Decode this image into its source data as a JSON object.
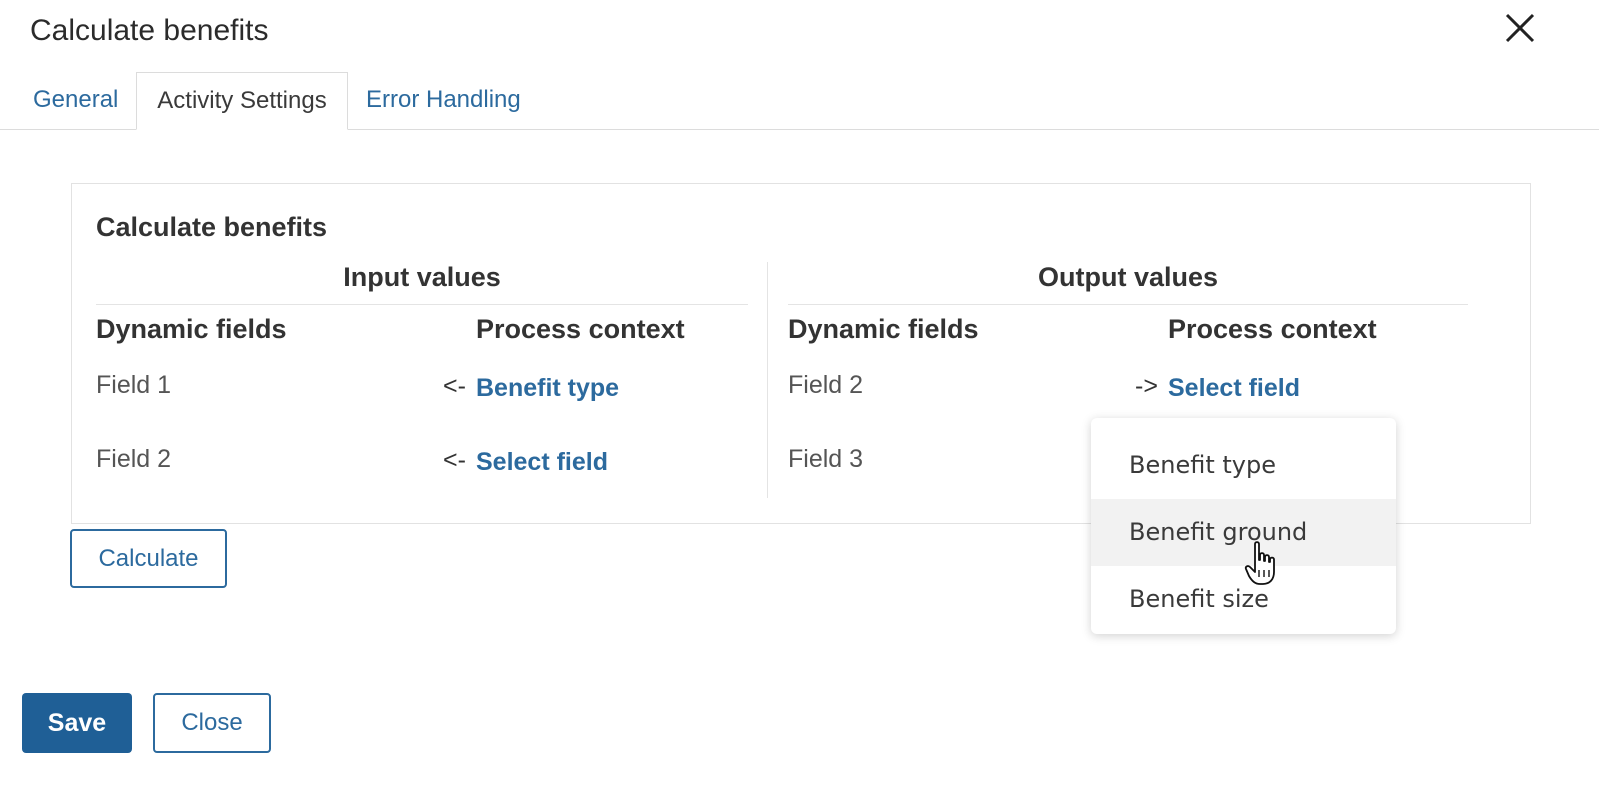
{
  "dialog": {
    "title": "Calculate benefits",
    "close_icon": "close-icon"
  },
  "tabs": [
    {
      "label": "General",
      "active": false
    },
    {
      "label": "Activity Settings",
      "active": true
    },
    {
      "label": "Error Handling",
      "active": false
    }
  ],
  "panel": {
    "title": "Calculate benefits",
    "input": {
      "heading": "Input values",
      "col_dynamic": "Dynamic fields",
      "col_context": "Process context",
      "rows": [
        {
          "field": "Field 1",
          "arrow": "<-",
          "link": "Benefit type"
        },
        {
          "field": "Field 2",
          "arrow": "<-",
          "link": "Select field"
        }
      ]
    },
    "output": {
      "heading": "Output values",
      "col_dynamic": "Dynamic fields",
      "col_context": "Process context",
      "rows": [
        {
          "field": "Field 2",
          "arrow": "->",
          "link": "Select field"
        },
        {
          "field": "Field 3"
        }
      ]
    }
  },
  "dropdown": {
    "options": [
      "Benefit type",
      "Benefit ground",
      "Benefit size"
    ],
    "hovered": "Benefit ground"
  },
  "buttons": {
    "calculate": "Calculate",
    "save": "Save",
    "close": "Close"
  },
  "colors": {
    "accent": "#2c6a9e",
    "primary_button": "#1f5f96",
    "hover_bg": "#f2f2f2"
  }
}
